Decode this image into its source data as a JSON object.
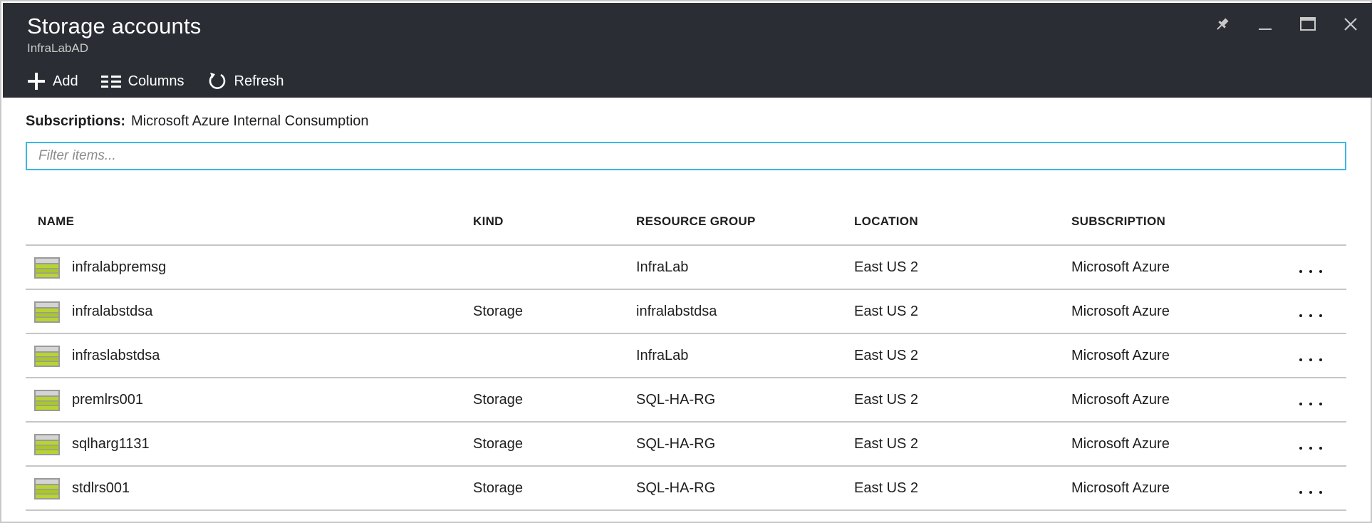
{
  "header": {
    "title": "Storage accounts",
    "subtitle": "InfraLabAD",
    "background": "#2a2e34"
  },
  "window_controls": [
    "pin-icon",
    "minimize-icon",
    "maximize-icon",
    "close-icon"
  ],
  "toolbar": {
    "add_label": "Add",
    "columns_label": "Columns",
    "refresh_label": "Refresh"
  },
  "subscriptions": {
    "label": "Subscriptions:",
    "value": "Microsoft Azure Internal Consumption"
  },
  "filter": {
    "placeholder": "Filter items...",
    "value": "",
    "border_color": "#3ab7e6"
  },
  "table": {
    "columns": [
      "NAME",
      "KIND",
      "RESOURCE GROUP",
      "LOCATION",
      "SUBSCRIPTION"
    ],
    "rows": [
      {
        "name": "infralabpremsg",
        "kind": "",
        "resource_group": "InfraLab",
        "location": "East US 2",
        "subscription": "Microsoft Azure"
      },
      {
        "name": "infralabstdsa",
        "kind": "Storage",
        "resource_group": "infralabstdsa",
        "location": "East US 2",
        "subscription": "Microsoft Azure"
      },
      {
        "name": "infraslabstdsa",
        "kind": "",
        "resource_group": "InfraLab",
        "location": "East US 2",
        "subscription": "Microsoft Azure"
      },
      {
        "name": "premlrs001",
        "kind": "Storage",
        "resource_group": "SQL-HA-RG",
        "location": "East US 2",
        "subscription": "Microsoft Azure"
      },
      {
        "name": "sqlharg1131",
        "kind": "Storage",
        "resource_group": "SQL-HA-RG",
        "location": "East US 2",
        "subscription": "Microsoft Azure"
      },
      {
        "name": "stdlrs001",
        "kind": "Storage",
        "resource_group": "SQL-HA-RG",
        "location": "East US 2",
        "subscription": "Microsoft Azure"
      }
    ],
    "row_icon": "storage-account-icon",
    "row_action_icon": "more-options-icon"
  }
}
